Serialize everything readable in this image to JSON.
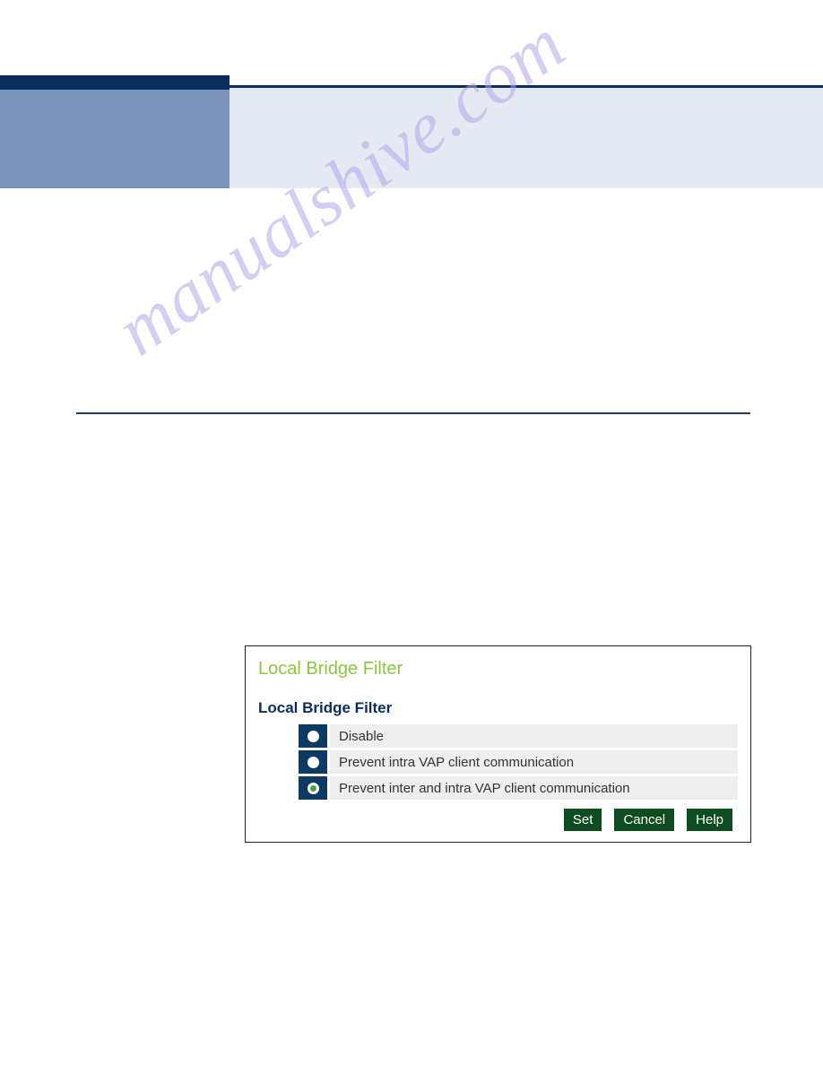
{
  "watermark": "manualshive.com",
  "panel": {
    "title": "Local Bridge Filter",
    "subtitle": "Local Bridge Filter",
    "options": [
      {
        "label": "Disable",
        "selected": false
      },
      {
        "label": "Prevent intra VAP client communication",
        "selected": false
      },
      {
        "label": "Prevent inter and intra VAP client communication",
        "selected": true
      }
    ],
    "buttons": {
      "set": "Set",
      "cancel": "Cancel",
      "help": "Help"
    }
  }
}
